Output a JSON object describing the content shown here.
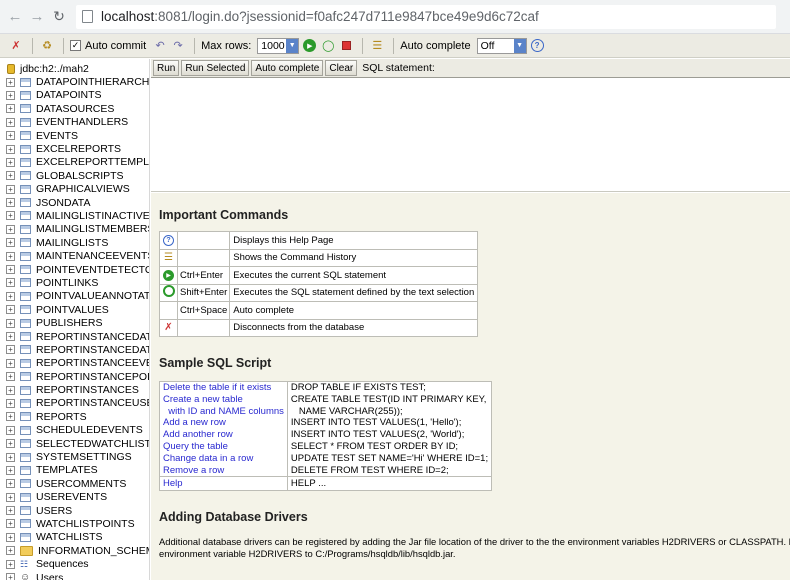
{
  "browser": {
    "url_host": "localhost",
    "url_rest": ":8081/login.do?jsessionid=f0afc247d711e9847bce49e9d6c72caf"
  },
  "toolbar": {
    "auto_commit_label": "Auto commit",
    "auto_commit_checked": true,
    "max_rows_label": "Max rows:",
    "max_rows_value": "1000",
    "auto_complete_label": "Auto complete",
    "auto_complete_value": "Off"
  },
  "tree": {
    "root": "jdbc:h2:./mah2",
    "tables": [
      "DATAPOINTHIERARCHY",
      "DATAPOINTS",
      "DATASOURCES",
      "EVENTHANDLERS",
      "EVENTS",
      "EXCELREPORTS",
      "EXCELREPORTTEMPLATES",
      "GLOBALSCRIPTS",
      "GRAPHICALVIEWS",
      "JSONDATA",
      "MAILINGLISTINACTIVE",
      "MAILINGLISTMEMBERS",
      "MAILINGLISTS",
      "MAINTENANCEEVENTS",
      "POINTEVENTDETECTORS",
      "POINTLINKS",
      "POINTVALUEANNOTATIONS",
      "POINTVALUES",
      "PUBLISHERS",
      "REPORTINSTANCEDATA",
      "REPORTINSTANCEDATAANNOTATIONS",
      "REPORTINSTANCEEVENTS",
      "REPORTINSTANCEPOINTS",
      "REPORTINSTANCES",
      "REPORTINSTANCEUSERCOMMENTS",
      "REPORTS",
      "SCHEDULEDEVENTS",
      "SELECTEDWATCHLIST",
      "SYSTEMSETTINGS",
      "TEMPLATES",
      "USERCOMMENTS",
      "USEREVENTS",
      "USERS",
      "WATCHLISTPOINTS",
      "WATCHLISTS"
    ],
    "schema": "INFORMATION_SCHEMA",
    "sequences": "Sequences",
    "users": "Users"
  },
  "sql": {
    "buttons": [
      "Run",
      "Run Selected",
      "Auto complete",
      "Clear"
    ],
    "statement_label": "SQL statement:"
  },
  "help": {
    "important_title": "Important Commands",
    "commands": [
      {
        "icon": "help-icon",
        "key": "",
        "desc": "Displays this Help Page"
      },
      {
        "icon": "history-icon",
        "key": "",
        "desc": "Shows the Command History"
      },
      {
        "icon": "run-icon",
        "key": "Ctrl+Enter",
        "desc": "Executes the current SQL statement"
      },
      {
        "icon": "run-selected-icon",
        "key": "Shift+Enter",
        "desc": "Executes the SQL statement defined by the text selection"
      },
      {
        "icon": "",
        "key": "Ctrl+Space",
        "desc": "Auto complete"
      },
      {
        "icon": "disconnect-icon",
        "key": "",
        "desc": "Disconnects from the database"
      }
    ],
    "sample_title": "Sample SQL Script",
    "script": [
      {
        "label": "Delete the table if it exists",
        "sql": "DROP TABLE IF EXISTS TEST;"
      },
      {
        "label": "Create a new table",
        "sql": "CREATE TABLE TEST(ID INT PRIMARY KEY,"
      },
      {
        "label": "  with ID and NAME columns",
        "sql": "   NAME VARCHAR(255));"
      },
      {
        "label": "Add a new row",
        "sql": "INSERT INTO TEST VALUES(1, 'Hello');"
      },
      {
        "label": "Add another row",
        "sql": "INSERT INTO TEST VALUES(2, 'World');"
      },
      {
        "label": "Query the table",
        "sql": "SELECT * FROM TEST ORDER BY ID;"
      },
      {
        "label": "Change data in a row",
        "sql": "UPDATE TEST SET NAME='Hi' WHERE ID=1;"
      },
      {
        "label": "Remove a row",
        "sql": "DELETE FROM TEST WHERE ID=2;"
      }
    ],
    "help_row": {
      "label": "Help",
      "sql": "HELP ..."
    },
    "drivers_title": "Adding Database Drivers",
    "drivers_line1": "Additional database drivers can be registered by adding the Jar file location of the driver to the the environment variables H2DRIVERS or CLASSPATH. Example",
    "drivers_line2": "environment variable H2DRIVERS to C:/Programs/hsqldb/lib/hsqldb.jar."
  }
}
